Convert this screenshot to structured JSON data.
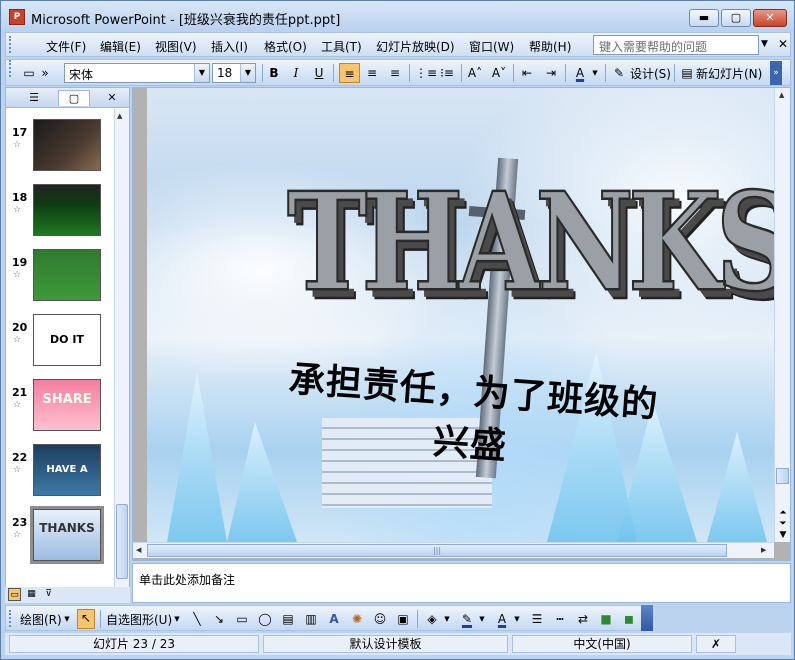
{
  "window": {
    "title": "Microsoft PowerPoint - [班级兴衰我的责任ppt.ppt]",
    "app_icon": "powerpoint-icon",
    "controls": {
      "minimize": "▬",
      "maximize": "▢",
      "close": "✕"
    }
  },
  "menubar": {
    "items": [
      "文件(F)",
      "编辑(E)",
      "视图(V)",
      "插入(I)",
      "格式(O)",
      "工具(T)",
      "幻灯片放映(D)",
      "窗口(W)",
      "帮助(H)"
    ],
    "help_placeholder": "键入需要帮助的问题",
    "close_glyph": "✕"
  },
  "toolbar": {
    "font_name": "宋体",
    "font_size": "18",
    "bold": "B",
    "italic": "I",
    "underline": "U",
    "design_label": "设计(S)",
    "new_slide_label": "新幻灯片(N)"
  },
  "slides_pane": {
    "tab_outline_glyph": "☰",
    "tab_slides_glyph": "▢",
    "close_glyph": "✕",
    "star": "☆",
    "thumbnails": [
      {
        "number": "17",
        "text": ""
      },
      {
        "number": "18",
        "text": ""
      },
      {
        "number": "19",
        "text": ""
      },
      {
        "number": "20",
        "text": "DO IT NOW"
      },
      {
        "number": "21",
        "text": "SHARE"
      },
      {
        "number": "22",
        "text": "HAVE A REST"
      },
      {
        "number": "23",
        "text": "THANKS"
      }
    ],
    "selected_slide": "23"
  },
  "slide": {
    "title": "THANKS",
    "subtitle": "承担责任，为了班级的兴盛"
  },
  "notes": {
    "placeholder": "单击此处添加备注"
  },
  "drawbar": {
    "draw_label": "绘图(R)",
    "autoshapes_label": "自选图形(U)"
  },
  "statusbar": {
    "slide_position": "幻灯片 23 / 23",
    "template": "默认设计模板",
    "language": "中文(中国)"
  }
}
